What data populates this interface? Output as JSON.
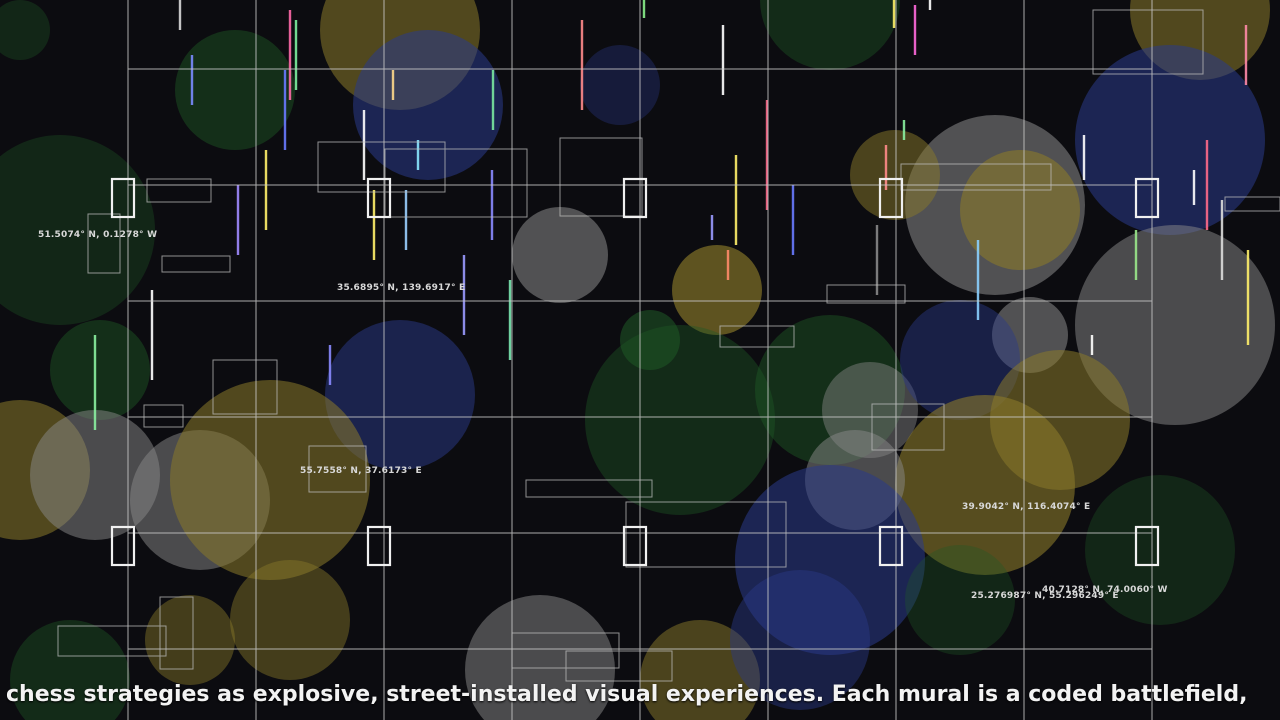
{
  "coordinates": [
    {
      "id": "london",
      "text": "51.5074° N, 0.1278° W"
    },
    {
      "id": "tokyo",
      "text": "35.6895° N, 139.6917° E"
    },
    {
      "id": "moscow",
      "text": "55.7558° N, 37.6173° E"
    },
    {
      "id": "beijing",
      "text": "39.9042° N, 116.4074° E"
    },
    {
      "id": "new-york",
      "text": "40.7128° N, 74.0060° W"
    },
    {
      "id": "dubai",
      "text": "25.276987° N, 55.296249° E"
    }
  ],
  "caption": "chess strategies as explosive, street-installed visual experiences. Each mural is a coded battlefield,",
  "colors": {
    "background": "#0c0c10",
    "grid_line": "#c8c8c8",
    "bokeh_green": "#1f5a26",
    "bokeh_blue": "#2a3a8a",
    "bokeh_yellow": "#8a7a2a",
    "bokeh_gray": "#8a8a8a"
  }
}
